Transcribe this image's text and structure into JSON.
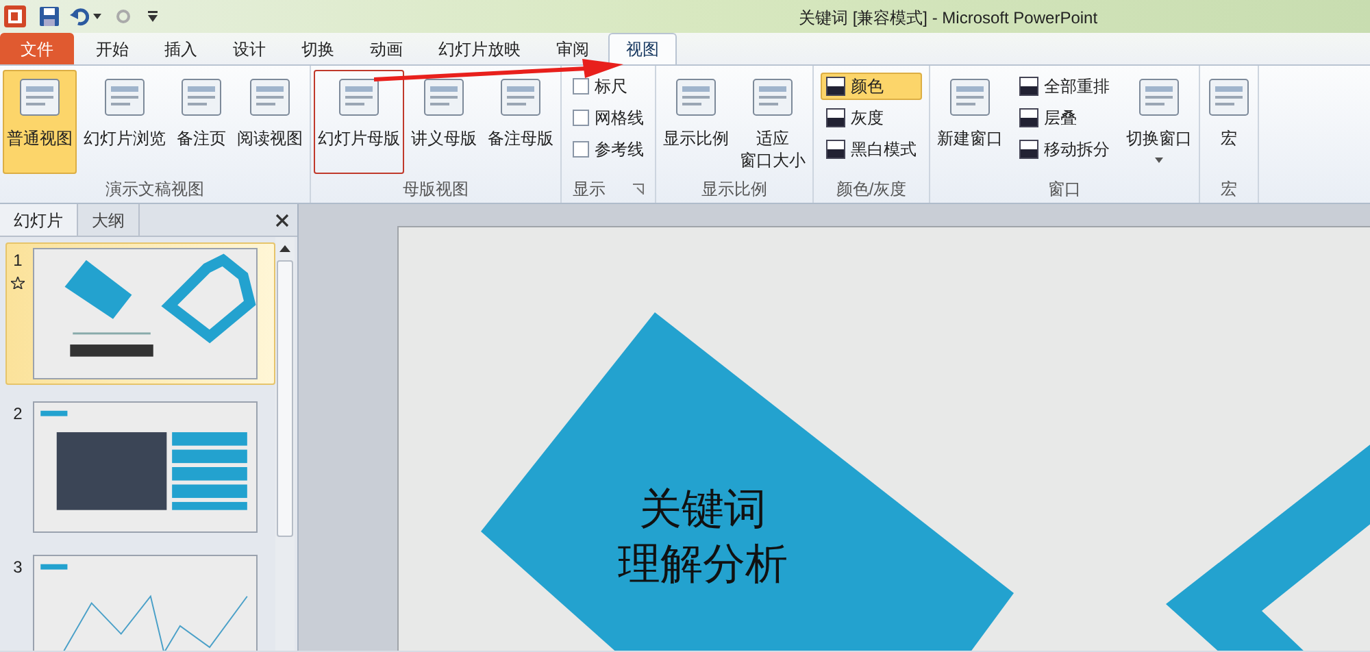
{
  "window": {
    "title": "关键词 [兼容模式] - Microsoft PowerPoint"
  },
  "tabs": [
    {
      "label": "文件",
      "kind": "file",
      "selected": false
    },
    {
      "label": "开始",
      "kind": "tab",
      "selected": false
    },
    {
      "label": "插入",
      "kind": "tab",
      "selected": false
    },
    {
      "label": "设计",
      "kind": "tab",
      "selected": false
    },
    {
      "label": "切换",
      "kind": "tab",
      "selected": false
    },
    {
      "label": "动画",
      "kind": "tab",
      "selected": false
    },
    {
      "label": "幻灯片放映",
      "kind": "tab",
      "selected": false
    },
    {
      "label": "审阅",
      "kind": "tab",
      "selected": false
    },
    {
      "label": "视图",
      "kind": "tab",
      "selected": true
    }
  ],
  "ribbon_groups": [
    {
      "label": "演示文稿视图",
      "launcher": false,
      "items": [
        {
          "kind": "large",
          "label": "普通视图",
          "selected": true,
          "highlighted": false
        },
        {
          "kind": "large",
          "label": "幻灯片浏览",
          "selected": false,
          "highlighted": false
        },
        {
          "kind": "large",
          "label": "备注页",
          "selected": false,
          "highlighted": false
        },
        {
          "kind": "large",
          "label": "阅读视图",
          "selected": false,
          "highlighted": false
        }
      ]
    },
    {
      "label": "母版视图",
      "launcher": false,
      "items": [
        {
          "kind": "large",
          "label": "幻灯片母版",
          "selected": false,
          "highlighted": true
        },
        {
          "kind": "large",
          "label": "讲义母版",
          "selected": false,
          "highlighted": false
        },
        {
          "kind": "large",
          "label": "备注母版",
          "selected": false,
          "highlighted": false
        }
      ]
    },
    {
      "label": "显示",
      "launcher": true,
      "items": [
        {
          "kind": "check",
          "label": "标尺",
          "checked": false
        },
        {
          "kind": "check",
          "label": "网格线",
          "checked": false
        },
        {
          "kind": "check",
          "label": "参考线",
          "checked": false
        }
      ]
    },
    {
      "label": "显示比例",
      "launcher": false,
      "items": [
        {
          "kind": "large",
          "label": "显示比例",
          "selected": false,
          "highlighted": false
        },
        {
          "kind": "large",
          "lines": [
            "适应",
            "窗口大小"
          ],
          "selected": false,
          "highlighted": false
        }
      ]
    },
    {
      "label": "颜色/灰度",
      "launcher": false,
      "items": [
        {
          "kind": "small",
          "label": "颜色",
          "selected": true
        },
        {
          "kind": "small",
          "label": "灰度",
          "selected": false
        },
        {
          "kind": "small",
          "label": "黑白模式",
          "selected": false
        }
      ]
    },
    {
      "label": "窗口",
      "launcher": false,
      "items": [
        {
          "kind": "large",
          "label": "新建窗口",
          "selected": false,
          "highlighted": false
        },
        {
          "kind": "small",
          "label": "全部重排",
          "selected": false
        },
        {
          "kind": "small",
          "label": "层叠",
          "selected": false
        },
        {
          "kind": "small",
          "label": "移动拆分",
          "selected": false
        },
        {
          "kind": "dropdown",
          "label": "切换窗口",
          "selected": false,
          "highlighted": false
        }
      ]
    },
    {
      "label": "宏",
      "launcher": false,
      "items": [
        {
          "kind": "large",
          "label": "宏",
          "selected": false,
          "highlighted": false
        }
      ]
    }
  ],
  "annotation_arrow": true,
  "panel": {
    "tabs": [
      {
        "label": "幻灯片",
        "selected": true
      },
      {
        "label": "大纲",
        "selected": false
      }
    ],
    "slides": [
      {
        "number": "1",
        "kind": "title",
        "selected": true,
        "animated": true
      },
      {
        "number": "2",
        "kind": "image",
        "selected": false,
        "animated": false
      },
      {
        "number": "3",
        "kind": "chart",
        "selected": false,
        "animated": false
      }
    ]
  },
  "slide": {
    "title_lines": [
      "关键词",
      "理解分析"
    ]
  }
}
